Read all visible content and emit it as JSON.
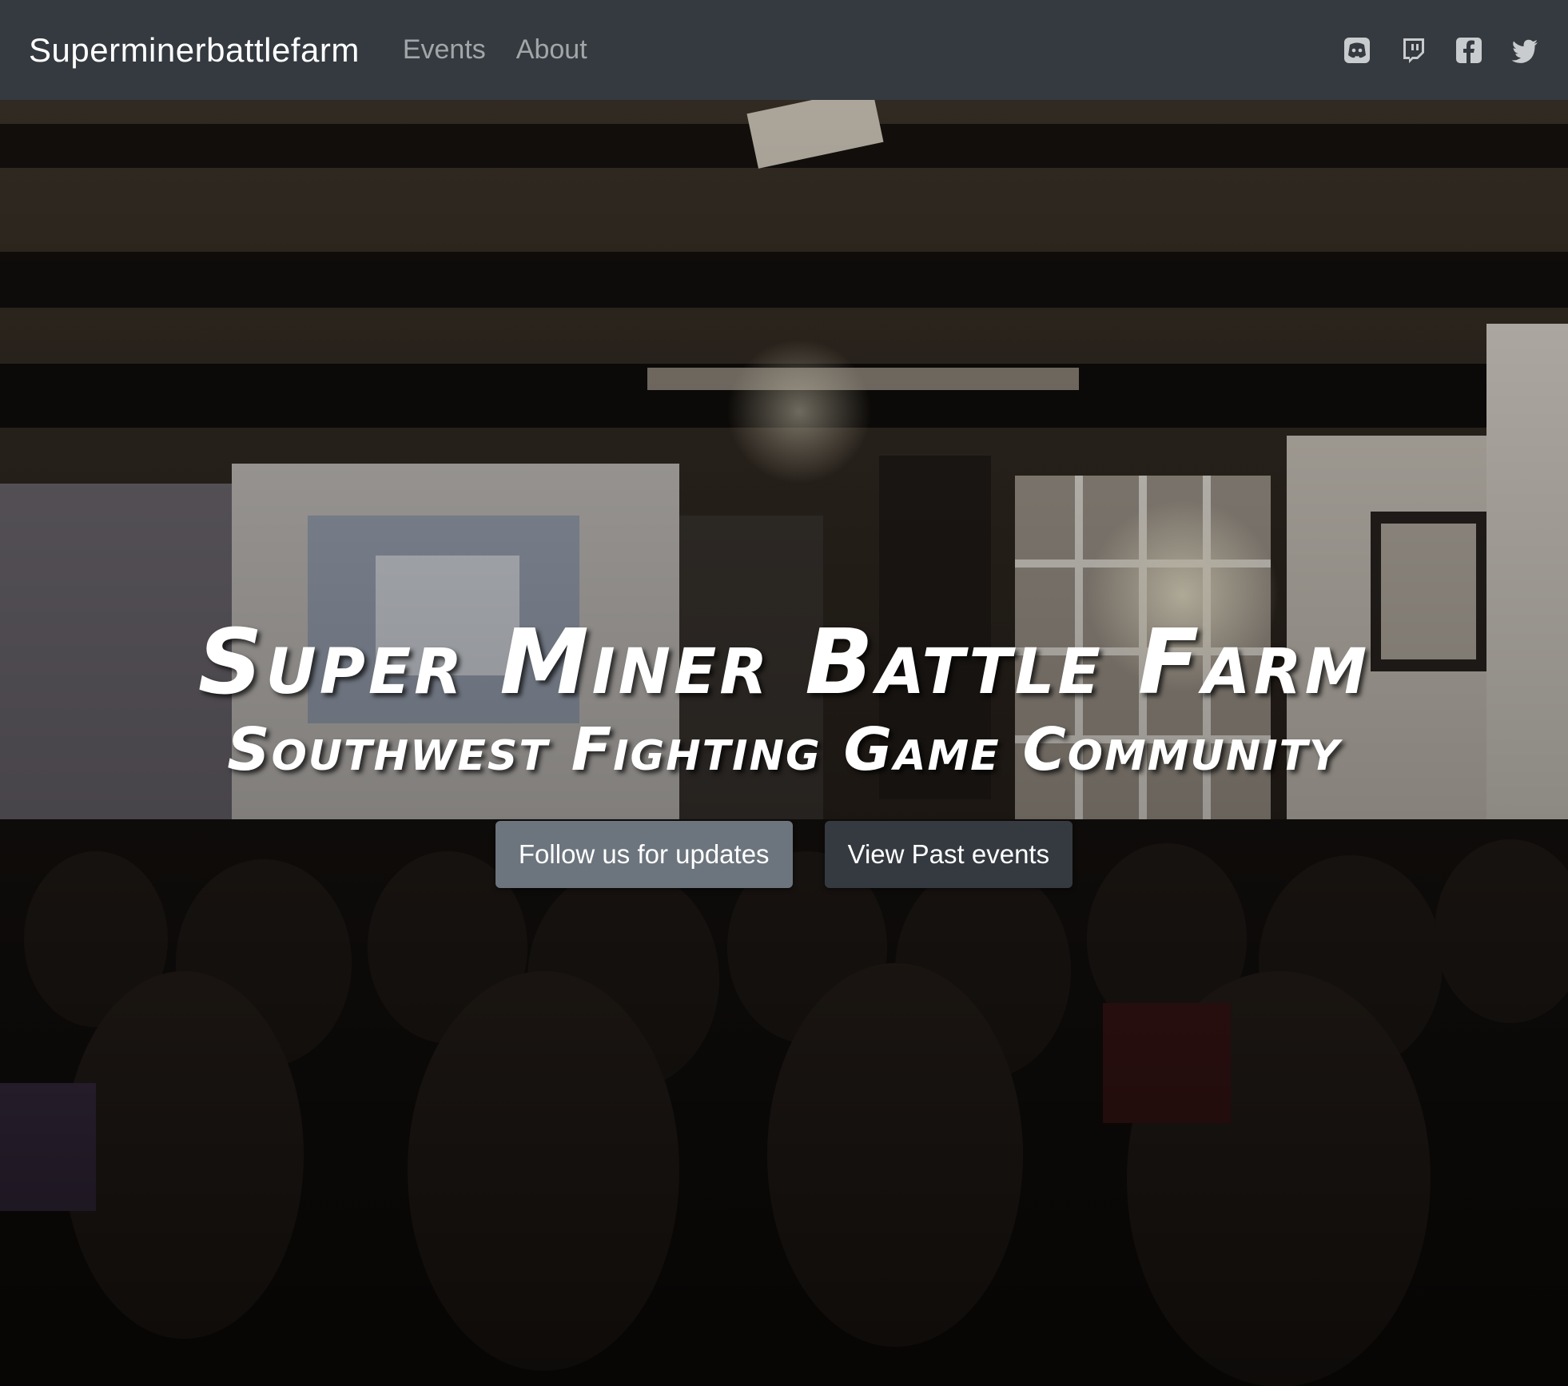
{
  "navbar": {
    "brand": "Superminerbattlefarm",
    "links": [
      "Events",
      "About"
    ],
    "social_icons": [
      "discord-icon",
      "twitch-icon",
      "facebook-icon",
      "twitter-icon"
    ],
    "background": "#343a40"
  },
  "hero": {
    "title": "Super Miner Battle Farm",
    "subtitle": "Southwest Fighting Game Community",
    "buttons": {
      "follow_label": "Follow us for updates",
      "past_events_label": "View Past events"
    },
    "colors": {
      "follow_button": "#6c757d",
      "past_events_button": "#343a40"
    }
  }
}
